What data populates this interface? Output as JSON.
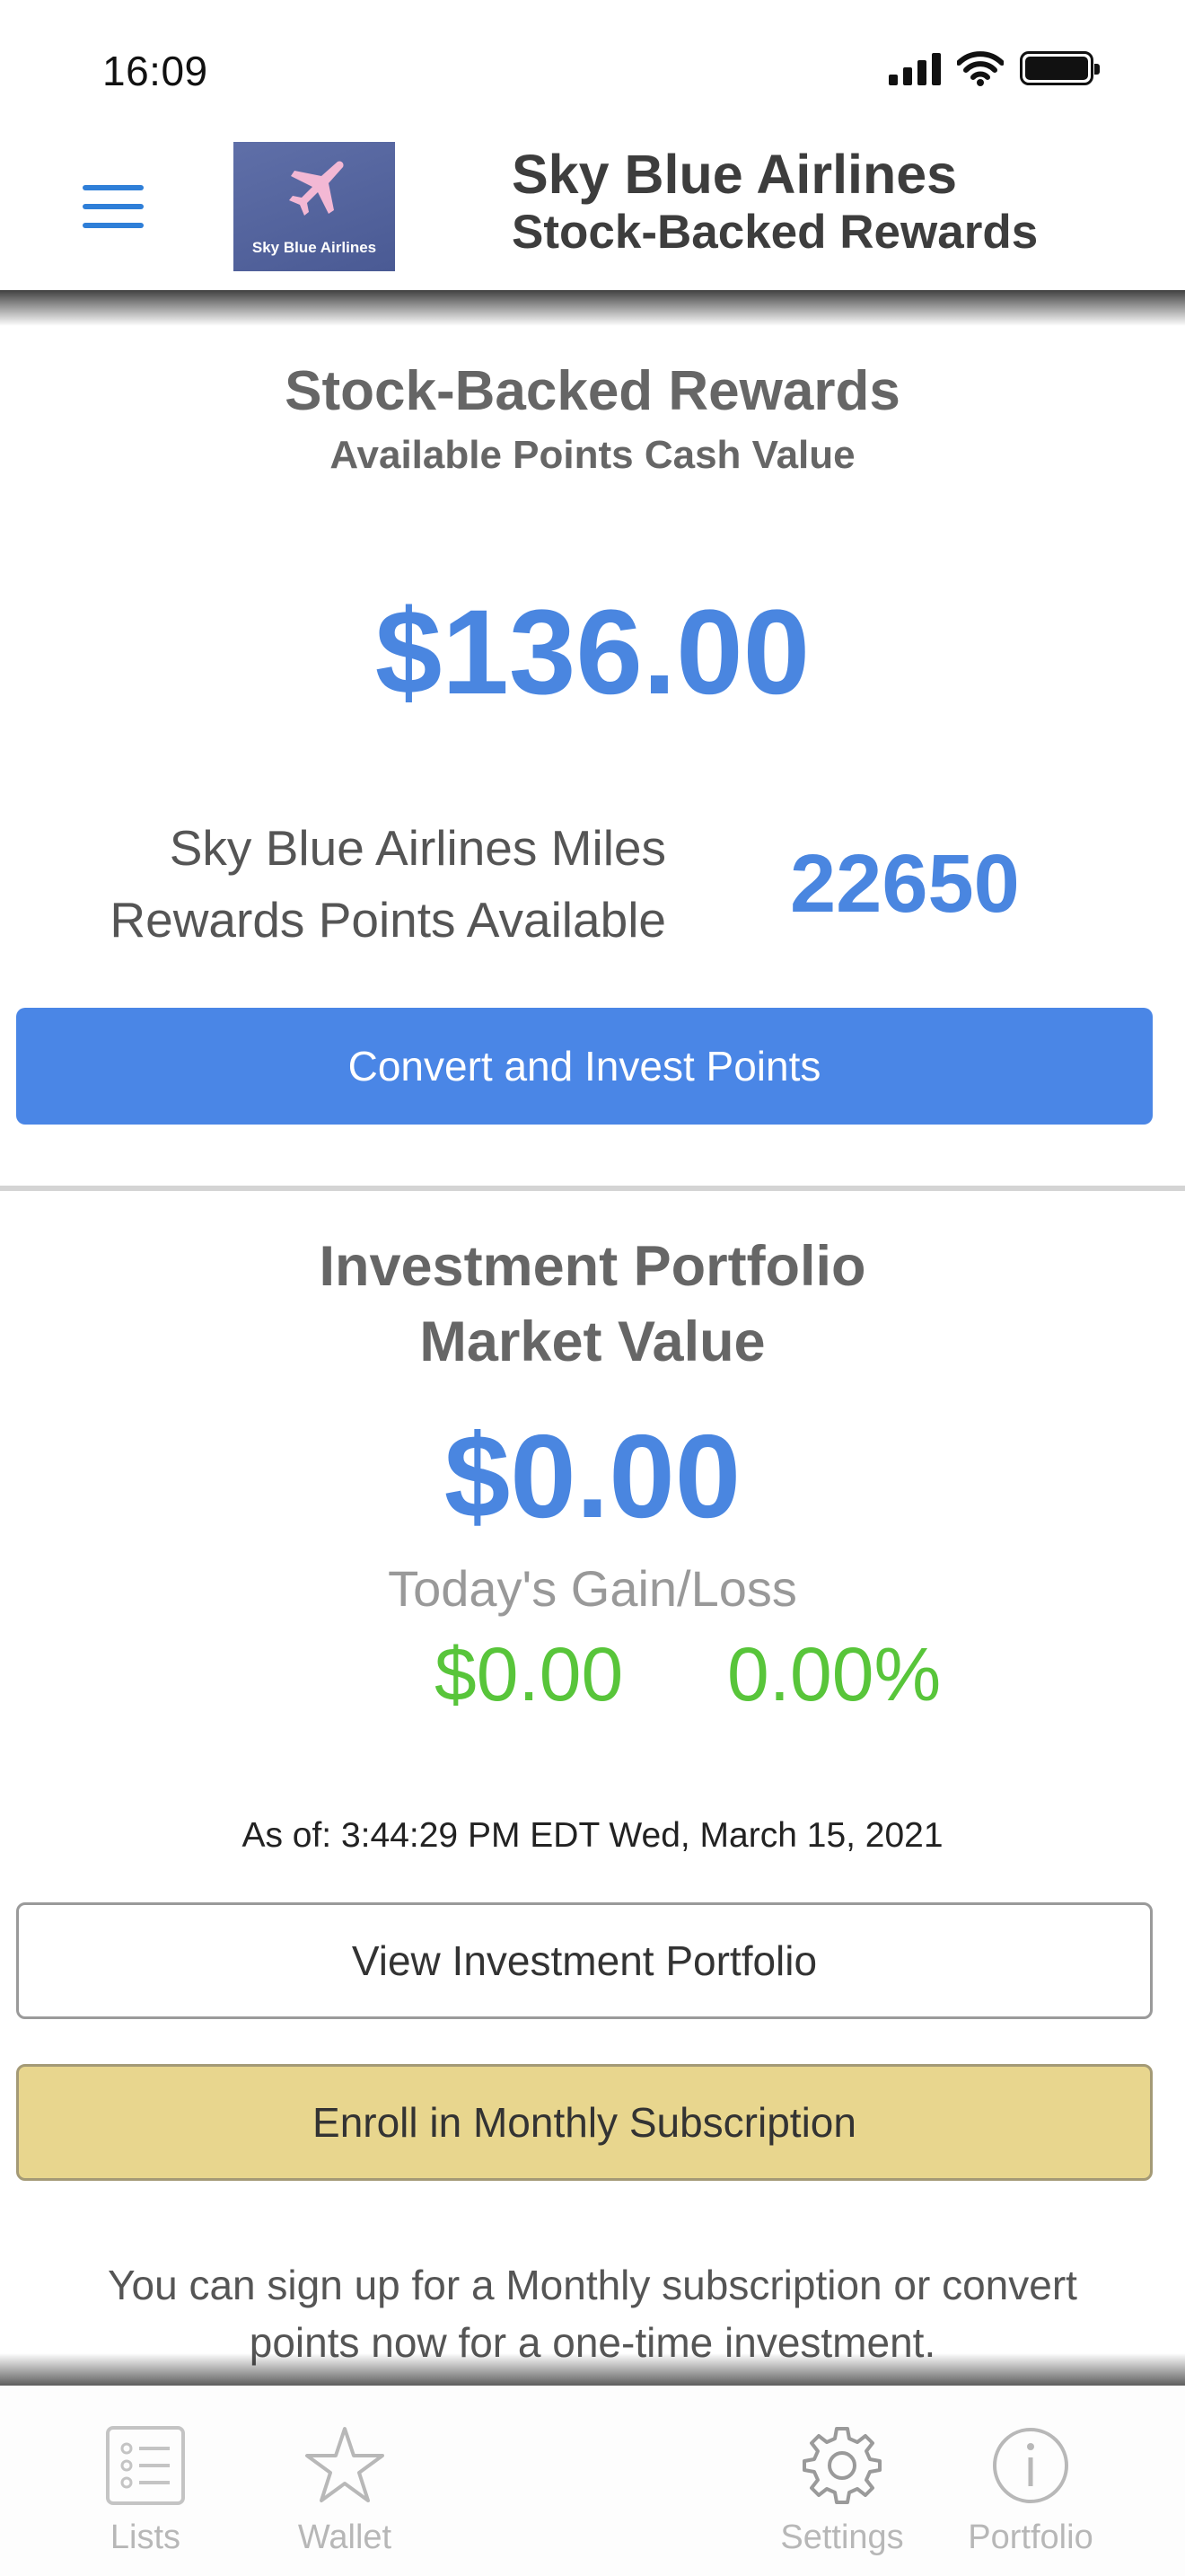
{
  "status_bar": {
    "time": "16:09"
  },
  "header": {
    "logo_text": "Sky Blue Airlines",
    "title": "Sky Blue Airlines",
    "subtitle": "Stock-Backed Rewards"
  },
  "rewards": {
    "title": "Stock-Backed Rewards",
    "subtitle": "Available Points Cash Value",
    "cash_value": "$136.00",
    "miles_label_line1": "Sky Blue Airlines Miles",
    "miles_label_line2": "Rewards Points Available",
    "points_available": "22650",
    "convert_button": "Convert and Invest Points"
  },
  "portfolio": {
    "title_line1": "Investment Portfolio",
    "title_line2": "Market Value",
    "market_value": "$0.00",
    "gain_label": "Today's Gain/Loss",
    "gain_amount": "$0.00",
    "gain_percent": "0.00%",
    "as_of": "As of: 3:44:29 PM EDT Wed, March 15, 2021",
    "view_button": "View Investment Portfolio",
    "enroll_button": "Enroll in Monthly Subscription",
    "info_text": "You can sign up for a Monthly subscription or convert points now for a one-time investment."
  },
  "tab_bar": {
    "items": [
      {
        "label": "Lists",
        "icon": "list-icon"
      },
      {
        "label": "Wallet",
        "icon": "star-icon"
      },
      {
        "label": "Settings",
        "icon": "gear-icon"
      },
      {
        "label": "Portfolio",
        "icon": "info-icon"
      }
    ]
  },
  "colors": {
    "accent_blue": "#4a86e6",
    "gain_green": "#58c53a",
    "enroll_gold": "#e8d68e",
    "menu_blue": "#2f7fd8"
  }
}
